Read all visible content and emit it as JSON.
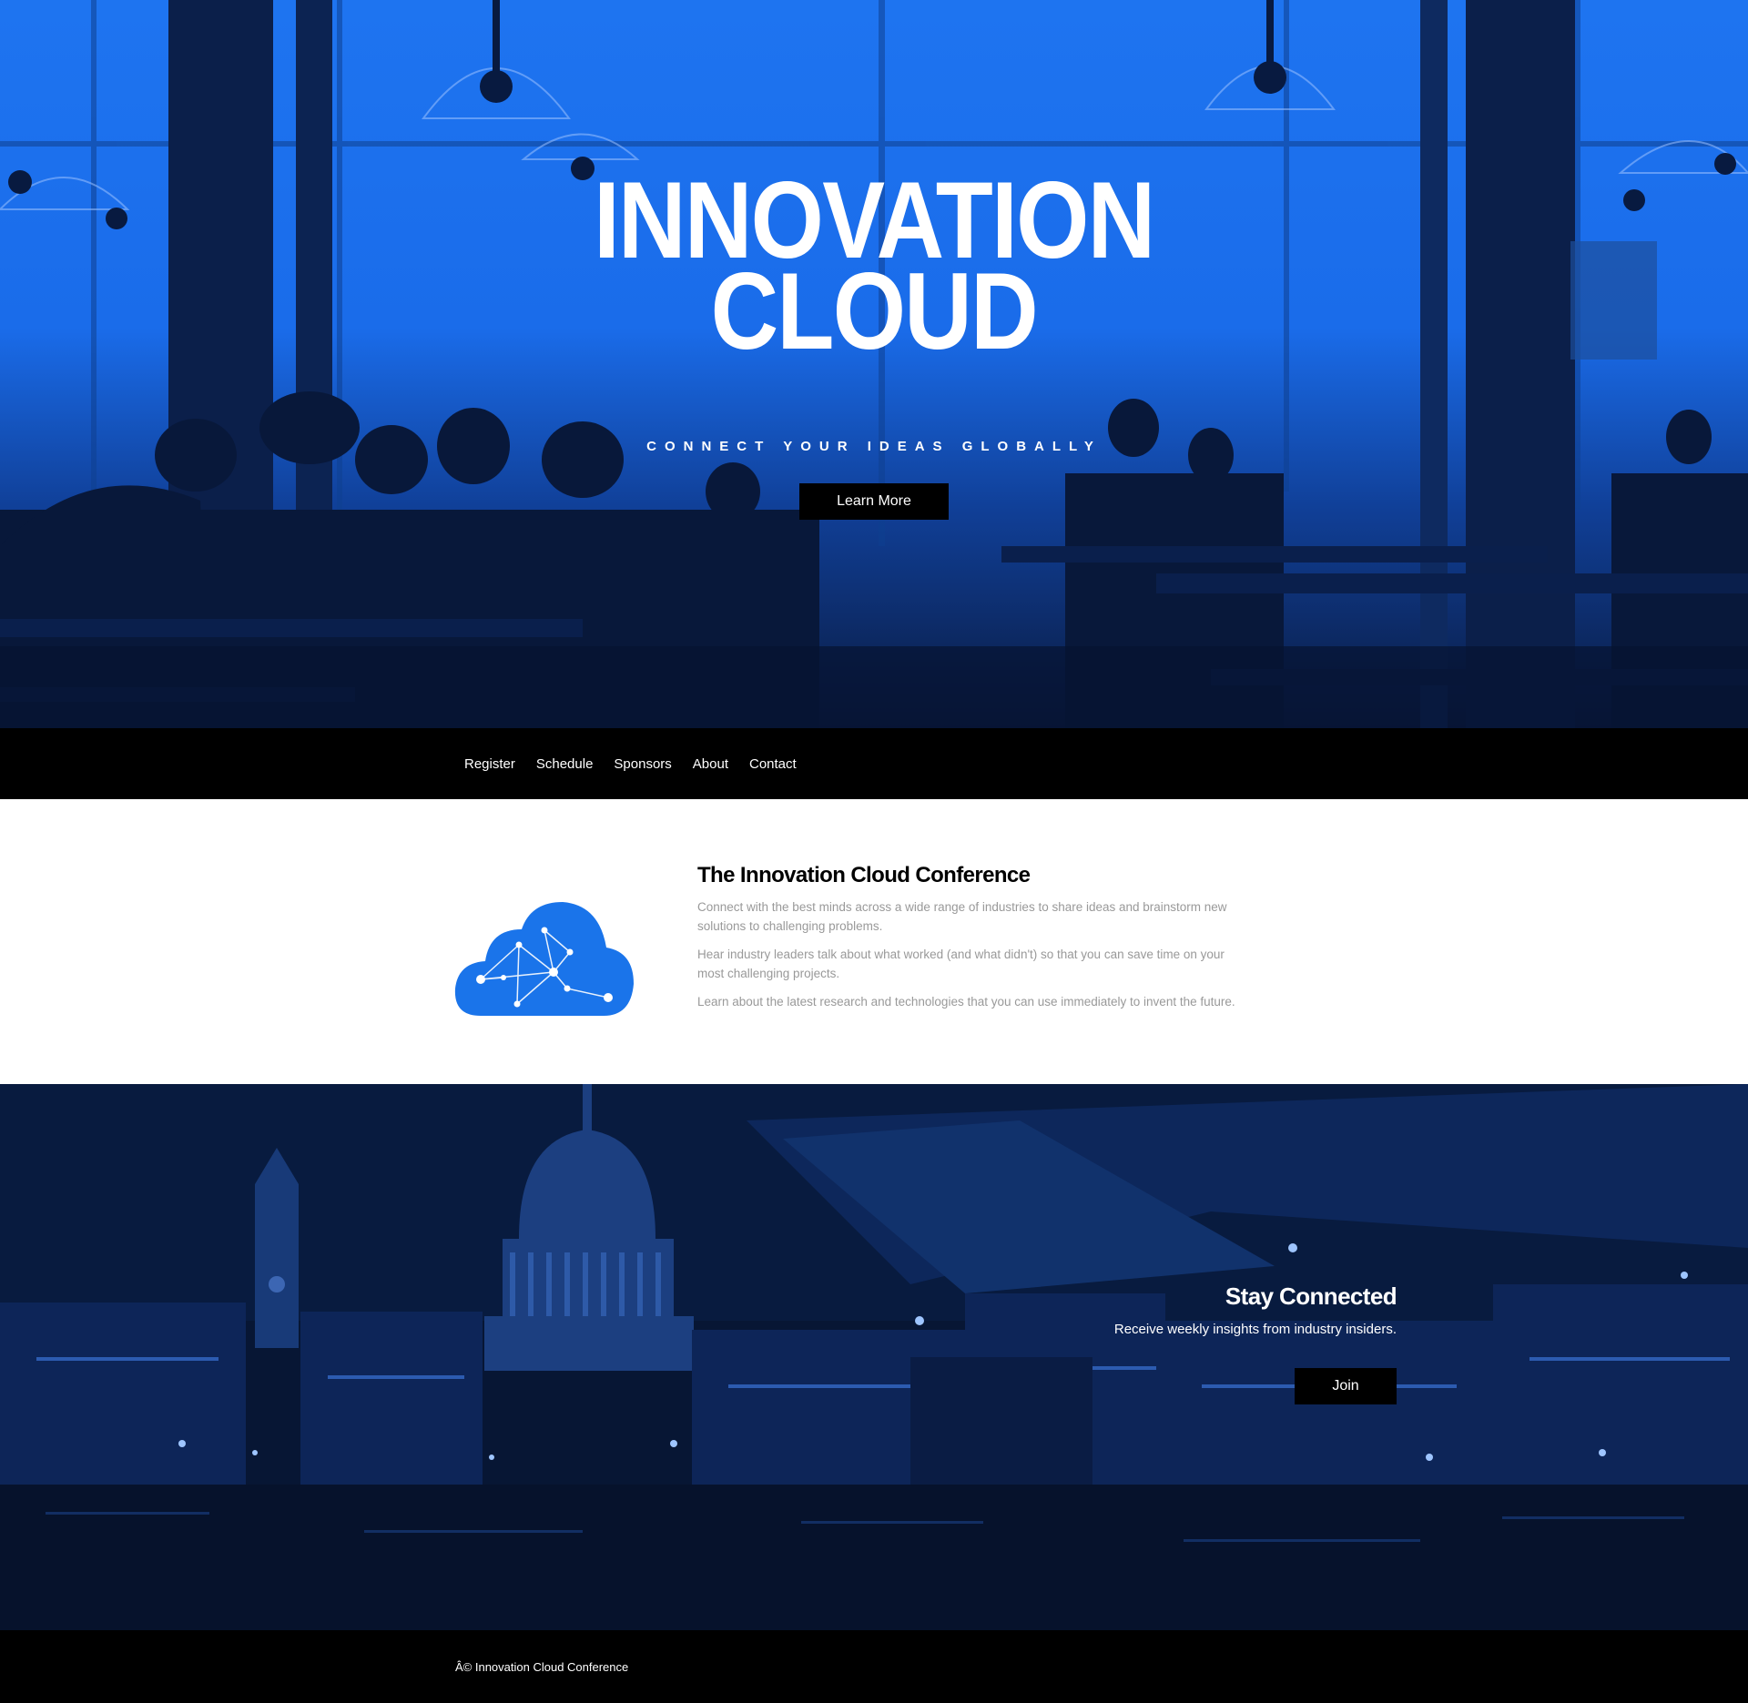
{
  "hero": {
    "title_line1": "INNOVATION",
    "title_line2": "CLOUD",
    "subtitle": "CONNECT YOUR IDEAS GLOBALLY",
    "cta_label": "Learn More"
  },
  "nav": {
    "items": [
      {
        "label": "Register"
      },
      {
        "label": "Schedule"
      },
      {
        "label": "Sponsors"
      },
      {
        "label": "About"
      },
      {
        "label": "Contact"
      }
    ]
  },
  "about": {
    "title": "The Innovation Cloud Conference",
    "paragraphs": [
      "Connect with the best minds across a wide range of industries to share ideas and brainstorm new solutions to challenging problems.",
      "Hear industry leaders talk about what worked (and what didn't) so that you can save time on your most challenging projects.",
      "Learn about the latest research and technologies that you can use immediately to invent the future."
    ],
    "icon": "cloud-network-icon"
  },
  "stay": {
    "title": "Stay Connected",
    "subtitle": "Receive weekly insights from industry insiders.",
    "button_label": "Join"
  },
  "footer": {
    "copyright": "Â© Innovation Cloud Conference"
  },
  "colors": {
    "hero_blue": "#1a6cea",
    "cloud_blue": "#1a74ea",
    "dark_navy": "#071733",
    "black": "#000000"
  }
}
